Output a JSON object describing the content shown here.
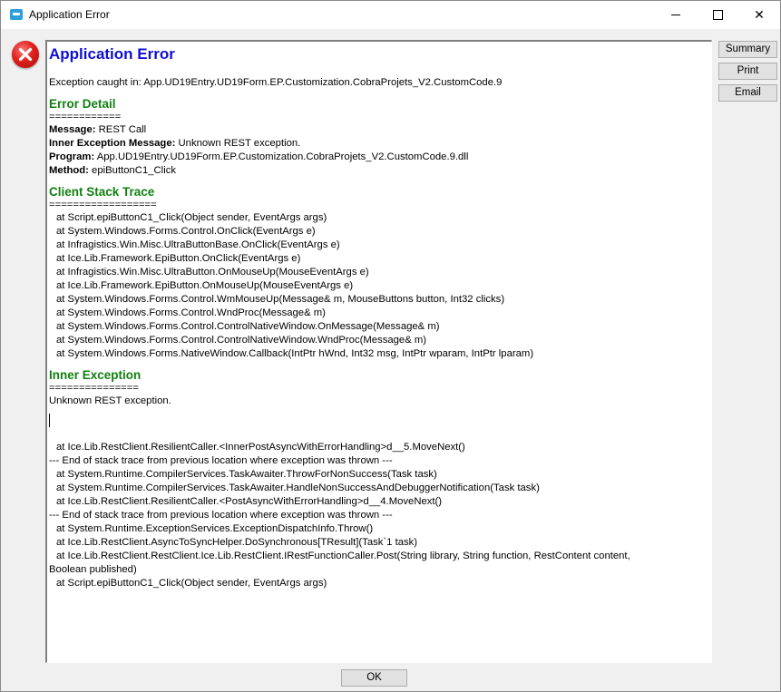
{
  "window": {
    "title": "Application Error",
    "minimize_glyph": "minimize",
    "maximize_glyph": "maximize",
    "close_glyph": "✕"
  },
  "header": {
    "title": "Application Error",
    "exception_caught": "Exception caught in: App.UD19Entry.UD19Form.EP.Customization.CobraProjets_V2.CustomCode.9"
  },
  "error_detail": {
    "heading": "Error Detail",
    "separator": "============",
    "fields": [
      {
        "label": "Message:",
        "value": " REST Call"
      },
      {
        "label": "Inner Exception Message:",
        "value": " Unknown REST exception."
      },
      {
        "label": "Program:",
        "value": " App.UD19Entry.UD19Form.EP.Customization.CobraProjets_V2.CustomCode.9.dll"
      },
      {
        "label": "Method:",
        "value": " epiButtonC1_Click"
      }
    ]
  },
  "client_stack": {
    "heading": "Client Stack Trace",
    "separator": "==================",
    "lines": [
      "at Script.epiButtonC1_Click(Object sender, EventArgs args)",
      "at System.Windows.Forms.Control.OnClick(EventArgs e)",
      "at Infragistics.Win.Misc.UltraButtonBase.OnClick(EventArgs e)",
      "at Ice.Lib.Framework.EpiButton.OnClick(EventArgs e)",
      "at Infragistics.Win.Misc.UltraButton.OnMouseUp(MouseEventArgs e)",
      "at Ice.Lib.Framework.EpiButton.OnMouseUp(MouseEventArgs e)",
      "at System.Windows.Forms.Control.WmMouseUp(Message& m, MouseButtons button, Int32 clicks)",
      "at System.Windows.Forms.Control.WndProc(Message& m)",
      "at System.Windows.Forms.Control.ControlNativeWindow.OnMessage(Message& m)",
      "at System.Windows.Forms.Control.ControlNativeWindow.WndProc(Message& m)",
      "at System.Windows.Forms.NativeWindow.Callback(IntPtr hWnd, Int32 msg, IntPtr wparam, IntPtr lparam)"
    ]
  },
  "inner_exception": {
    "heading": "Inner Exception",
    "separator": "===============",
    "message": "Unknown REST exception.",
    "trace": [
      {
        "text": "at Ice.Lib.RestClient.ResilientCaller.<InnerPostAsyncWithErrorHandling>d__5.MoveNext()",
        "indent": true
      },
      {
        "text": "--- End of stack trace from previous location where exception was thrown ---",
        "indent": false
      },
      {
        "text": "at System.Runtime.CompilerServices.TaskAwaiter.ThrowForNonSuccess(Task task)",
        "indent": true
      },
      {
        "text": "at System.Runtime.CompilerServices.TaskAwaiter.HandleNonSuccessAndDebuggerNotification(Task task)",
        "indent": true
      },
      {
        "text": "at Ice.Lib.RestClient.ResilientCaller.<PostAsyncWithErrorHandling>d__4.MoveNext()",
        "indent": true
      },
      {
        "text": "--- End of stack trace from previous location where exception was thrown ---",
        "indent": false
      },
      {
        "text": "at System.Runtime.ExceptionServices.ExceptionDispatchInfo.Throw()",
        "indent": true
      },
      {
        "text": "at Ice.Lib.RestClient.AsyncToSyncHelper.DoSynchronous[TResult](Task`1 task)",
        "indent": true
      }
    ],
    "wrapped_line_1": "at Ice.Lib.RestClient.RestClient.Ice.Lib.RestClient.IRestFunctionCaller.Post(String library, String function, RestContent content,",
    "wrapped_line_2": "Boolean published)",
    "last_line": "at Script.epiButtonC1_Click(Object sender, EventArgs args)"
  },
  "side_buttons": {
    "summary": "Summary",
    "print": "Print",
    "email": "Email"
  },
  "footer": {
    "ok": "OK"
  },
  "colors": {
    "title_blue": "#1010d0",
    "section_green": "#108010",
    "error_red": "#e0201c"
  },
  "icons": {
    "app": "app-window-icon",
    "error": "error-x-icon"
  }
}
